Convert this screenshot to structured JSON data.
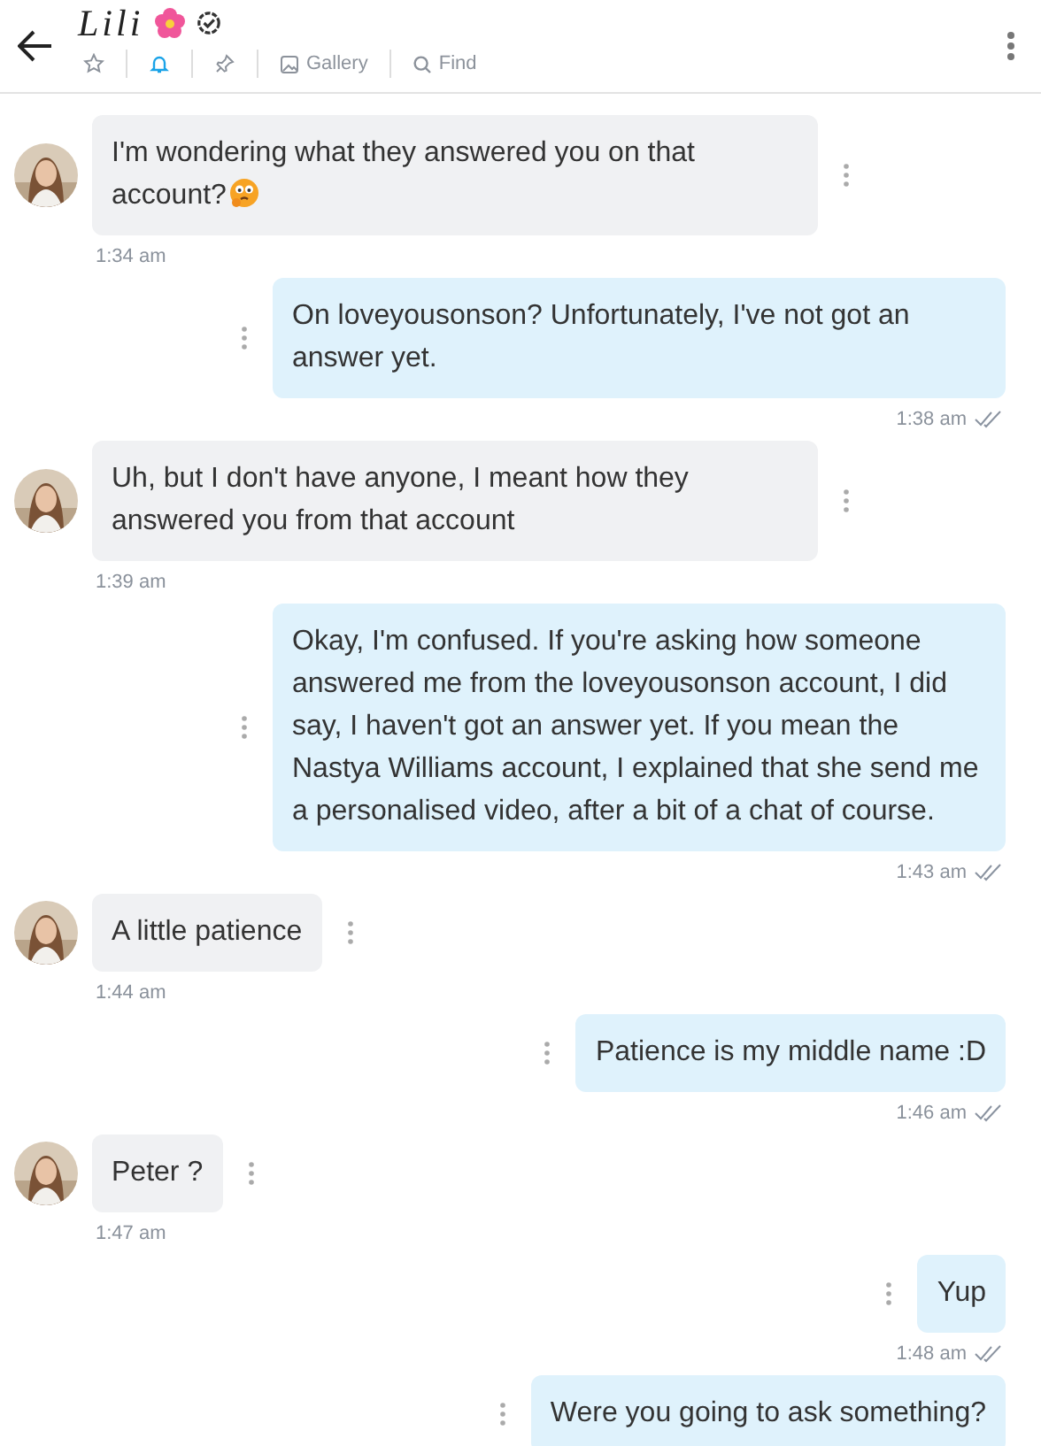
{
  "header": {
    "name": "Lili",
    "flower_emoji": true,
    "verified": true,
    "actions": [
      {
        "kind": "star",
        "active": false
      },
      {
        "kind": "bell",
        "active": true
      },
      {
        "kind": "pin",
        "active": false
      },
      {
        "kind": "gallery",
        "label": "Gallery",
        "active": false
      },
      {
        "kind": "find",
        "label": "Find",
        "active": false
      }
    ]
  },
  "messages": [
    {
      "kind": "in",
      "text": "I'm wondering what they answered you on that account?",
      "emoji": true,
      "time": "1:34 am"
    },
    {
      "kind": "out",
      "text": "On loveyousonson? Unfortunately, I've not got an answer yet.",
      "time": "1:38 am",
      "read": true
    },
    {
      "kind": "in",
      "text": "Uh, but I don't have anyone, I meant how they answered you from that account",
      "time": "1:39 am"
    },
    {
      "kind": "out",
      "text": "Okay, I'm confused. If you're asking how someone answered me from the loveyousonson account, I did say, I haven't got an answer yet. If you mean the Nastya Williams account, I explained that she send me a personalised video, after a bit of a chat of course.",
      "time": "1:43 am",
      "read": true
    },
    {
      "kind": "in",
      "text": "A little patience",
      "time": "1:44 am"
    },
    {
      "kind": "out",
      "text": "Patience is my middle name :D",
      "time": "1:46 am",
      "read": true
    },
    {
      "kind": "in",
      "text": "Peter ?",
      "time": "1:47 am"
    },
    {
      "kind": "out",
      "text": "Yup",
      "time": "1:48 am",
      "read": true
    },
    {
      "kind": "out",
      "text": "Were you going to ask something?"
    }
  ]
}
